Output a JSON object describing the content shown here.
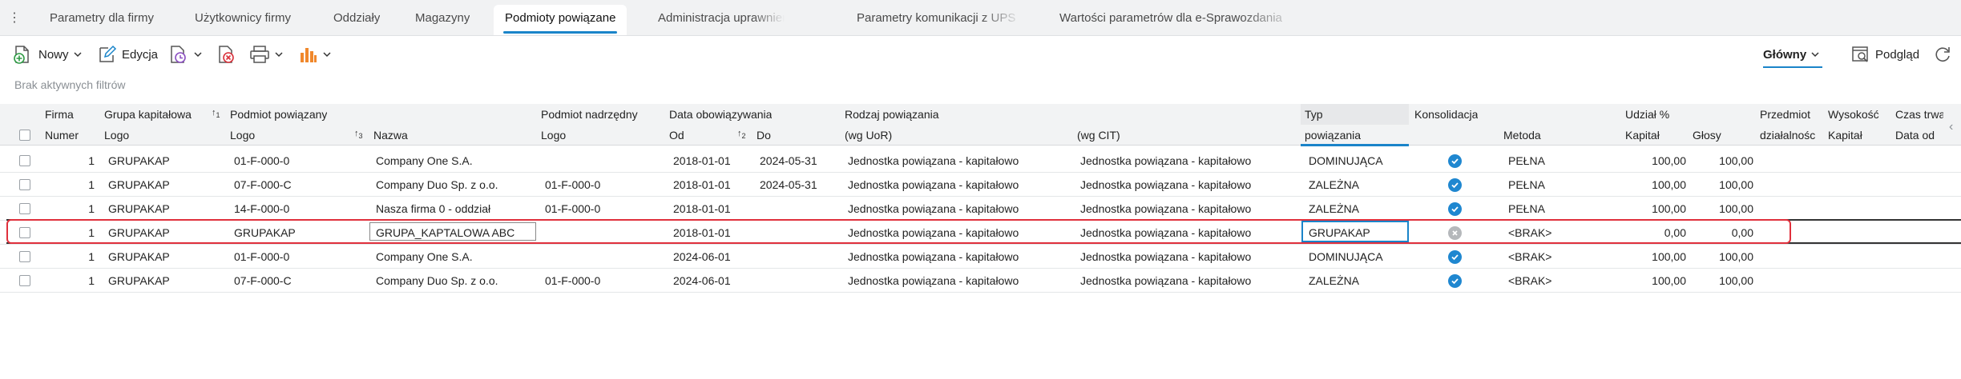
{
  "tabs": [
    {
      "label": "Parametry dla firmy",
      "active": false
    },
    {
      "label": "Użytkownicy firmy",
      "active": false
    },
    {
      "label": "Oddziały",
      "active": false
    },
    {
      "label": "Magazyny",
      "active": false
    },
    {
      "label": "Podmioty powiązane",
      "active": true
    },
    {
      "label": "Administracja uprawnieniami",
      "active": false
    },
    {
      "label": "Parametry komunikacji z UPS",
      "active": false
    },
    {
      "label": "Wartości parametrów dla e-Sprawozdania",
      "active": false
    }
  ],
  "toolbar": {
    "new_label": "Nowy",
    "edit_label": "Edycja",
    "view_select": "Główny",
    "preview_label": "Podgląd"
  },
  "filters_text": "Brak aktywnych filtrów",
  "header_top": {
    "firma": "Firma",
    "grupa": "Grupa kapitałowa",
    "podmiot": "Podmiot powiązany",
    "nadrzedny": "Podmiot nadrzędny",
    "data": "Data obowiązywania",
    "rodzaj": "Rodzaj powiązania",
    "typ": "Typ",
    "konsolidacja": "Konsolidacja",
    "udzial": "Udział %",
    "przedmiot": "Przedmiot",
    "wysokosc": "Wysokość",
    "czas": "Czas trwa"
  },
  "header_bottom": {
    "numer": "Numer",
    "grupa_logo": "Logo",
    "podmiot_logo": "Logo",
    "nazwa": "Nazwa",
    "nadrzedny_logo": "Logo",
    "od": "Od",
    "do": "Do",
    "uor": "(wg UoR)",
    "cit": "(wg CIT)",
    "typ": "powiązania",
    "metoda": "Metoda",
    "kapital": "Kapitał",
    "glosy": "Głosy",
    "dzialalnosc": "działalnośc",
    "wys_kapital": "Kapitał",
    "data_od": "Data od"
  },
  "sort": {
    "grupa": "1",
    "podmiot": "3",
    "od": "2"
  },
  "rows": [
    {
      "numer": "1",
      "grupa": "GRUPAKAP",
      "podmiot": "01-F-000-0",
      "nazwa": "Company One S.A.",
      "nadrzedny": "",
      "od": "2018-01-01",
      "do": "2024-05-31",
      "uor": "Jednostka powiązana - kapitałowo",
      "cit": "Jednostka powiązana - kapitałowo",
      "typ": "DOMINUJĄCA",
      "konsolidacja": true,
      "metoda": "PEŁNA",
      "kapital": "100,00",
      "glosy": "100,00"
    },
    {
      "numer": "1",
      "grupa": "GRUPAKAP",
      "podmiot": "07-F-000-C",
      "nazwa": "Company Duo Sp. z o.o.",
      "nadrzedny": "01-F-000-0",
      "od": "2018-01-01",
      "do": "2024-05-31",
      "uor": "Jednostka powiązana - kapitałowo",
      "cit": "Jednostka powiązana - kapitałowo",
      "typ": "ZALEŻNA",
      "konsolidacja": true,
      "metoda": "PEŁNA",
      "kapital": "100,00",
      "glosy": "100,00"
    },
    {
      "numer": "1",
      "grupa": "GRUPAKAP",
      "podmiot": "14-F-000-0",
      "nazwa": "Nasza firma 0 - oddział",
      "nadrzedny": "01-F-000-0",
      "od": "2018-01-01",
      "do": "",
      "uor": "Jednostka powiązana - kapitałowo",
      "cit": "Jednostka powiązana - kapitałowo",
      "typ": "ZALEŻNA",
      "konsolidacja": true,
      "metoda": "PEŁNA",
      "kapital": "100,00",
      "glosy": "100,00"
    },
    {
      "numer": "1",
      "grupa": "GRUPAKAP",
      "podmiot": "GRUPAKAP",
      "nazwa": "GRUPA_KAPTALOWA ABC",
      "nadrzedny": "",
      "od": "2018-01-01",
      "do": "",
      "uor": "Jednostka powiązana - kapitałowo",
      "cit": "Jednostka powiązana - kapitałowo",
      "typ": "GRUPAKAP",
      "konsolidacja": false,
      "metoda": "<BRAK>",
      "kapital": "0,00",
      "glosy": "0,00"
    },
    {
      "numer": "1",
      "grupa": "GRUPAKAP",
      "podmiot": "01-F-000-0",
      "nazwa": "Company One S.A.",
      "nadrzedny": "",
      "od": "2024-06-01",
      "do": "",
      "uor": "Jednostka powiązana - kapitałowo",
      "cit": "Jednostka powiązana - kapitałowo",
      "typ": "DOMINUJĄCA",
      "konsolidacja": true,
      "metoda": "<BRAK>",
      "kapital": "100,00",
      "glosy": "100,00"
    },
    {
      "numer": "1",
      "grupa": "GRUPAKAP",
      "podmiot": "07-F-000-C",
      "nazwa": "Company Duo Sp. z o.o.",
      "nadrzedny": "01-F-000-0",
      "od": "2024-06-01",
      "do": "",
      "uor": "Jednostka powiązana - kapitałowo",
      "cit": "Jednostka powiązana - kapitałowo",
      "typ": "ZALEŻNA",
      "konsolidacja": true,
      "metoda": "<BRAK>",
      "kapital": "100,00",
      "glosy": "100,00"
    }
  ],
  "icons": {
    "new": "new-document-icon",
    "edit": "edit-icon",
    "history": "document-clock-icon",
    "delete": "delete-document-icon",
    "print": "printer-icon",
    "chart": "bar-chart-icon",
    "preview": "preview-icon",
    "refresh": "refresh-icon"
  },
  "colors": {
    "accent": "#1a84c9",
    "selection_outline": "#e0303c",
    "chart_icon": "#f0882c",
    "delete_icon": "#d9303a"
  }
}
